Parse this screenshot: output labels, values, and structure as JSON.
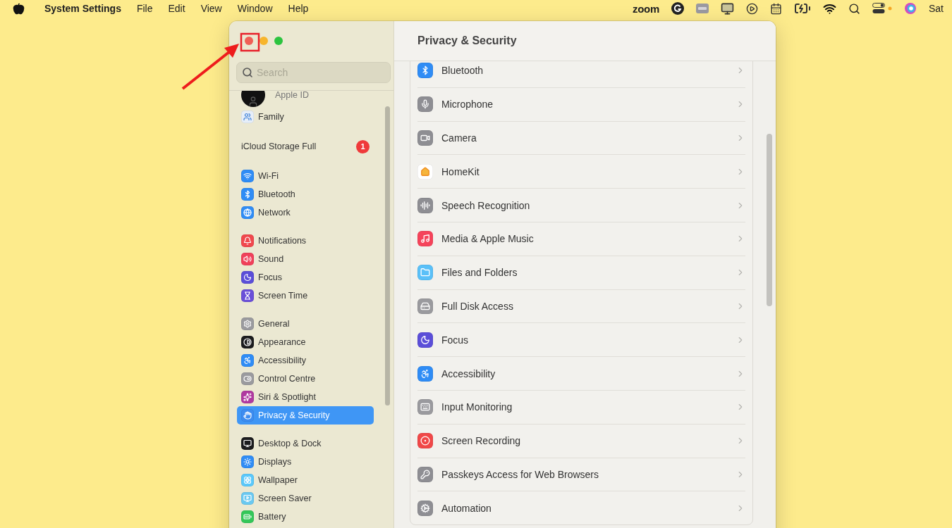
{
  "menu_bar": {
    "app_name": "System Settings",
    "menus": [
      "File",
      "Edit",
      "View",
      "Window",
      "Help"
    ],
    "status_logo": "zoom",
    "clock": "Sat"
  },
  "window": {
    "title": "Privacy & Security",
    "search": {
      "placeholder": "Search"
    },
    "sidebar": {
      "groups": [
        [
          {
            "kind": "avatar",
            "label": "Apple ID",
            "selected": false
          },
          {
            "kind": "icon",
            "label": "Family",
            "color": "#e6eef8",
            "selected": false
          }
        ],
        [
          {
            "kind": "notice",
            "label": "iCloud Storage Full",
            "badge": "1",
            "selected": false
          }
        ],
        [
          {
            "kind": "icon",
            "label": "Wi-Fi",
            "color": "#2f8cf5",
            "selected": false
          },
          {
            "kind": "icon",
            "label": "Bluetooth",
            "color": "#2f8cf5",
            "selected": false
          },
          {
            "kind": "icon",
            "label": "Network",
            "color": "#2f8cf5",
            "selected": false
          }
        ],
        [
          {
            "kind": "icon",
            "label": "Notifications",
            "color": "#f0484d",
            "selected": false
          },
          {
            "kind": "icon",
            "label": "Sound",
            "color": "#f0405a",
            "selected": false
          },
          {
            "kind": "icon",
            "label": "Focus",
            "color": "#5b4ed8",
            "selected": false
          },
          {
            "kind": "icon",
            "label": "Screen Time",
            "color": "#6a4fd8",
            "selected": false
          }
        ],
        [
          {
            "kind": "icon",
            "label": "General",
            "color": "#9a9a9e",
            "selected": false
          },
          {
            "kind": "icon",
            "label": "Appearance",
            "color": "#1c1c1e",
            "selected": false
          },
          {
            "kind": "icon",
            "label": "Accessibility",
            "color": "#2f8cf5",
            "selected": false
          },
          {
            "kind": "icon",
            "label": "Control Centre",
            "color": "#9a9a9e",
            "selected": false
          },
          {
            "kind": "icon",
            "label": "Siri & Spotlight",
            "color": "#b03aa0",
            "selected": false
          },
          {
            "kind": "icon",
            "label": "Privacy & Security",
            "color": "#3d8cf0",
            "selected": true
          }
        ],
        [
          {
            "kind": "icon",
            "label": "Desktop & Dock",
            "color": "#1c1c1e",
            "selected": false
          },
          {
            "kind": "icon",
            "label": "Displays",
            "color": "#2f8cf5",
            "selected": false
          },
          {
            "kind": "icon",
            "label": "Wallpaper",
            "color": "#5ac8fa",
            "selected": false
          },
          {
            "kind": "icon",
            "label": "Screen Saver",
            "color": "#6ac8f0",
            "selected": false
          },
          {
            "kind": "icon",
            "label": "Battery",
            "color": "#34c759",
            "selected": false
          }
        ]
      ]
    },
    "items": [
      {
        "label": "Bluetooth",
        "color": "#2f8cf5"
      },
      {
        "label": "Microphone",
        "color": "#8e8e93"
      },
      {
        "label": "Camera",
        "color": "#8e8e93"
      },
      {
        "label": "HomeKit",
        "color": "#ffffff"
      },
      {
        "label": "Speech Recognition",
        "color": "#8e8e93"
      },
      {
        "label": "Media & Apple Music",
        "color": "#f5435a"
      },
      {
        "label": "Files and Folders",
        "color": "#5ac0f8"
      },
      {
        "label": "Full Disk Access",
        "color": "#9a9a9e"
      },
      {
        "label": "Focus",
        "color": "#5b4ed8"
      },
      {
        "label": "Accessibility",
        "color": "#2f8cf5"
      },
      {
        "label": "Input Monitoring",
        "color": "#9a9a9e"
      },
      {
        "label": "Screen Recording",
        "color": "#f04848"
      },
      {
        "label": "Passkeys Access for Web Browsers",
        "color": "#8e8e93"
      },
      {
        "label": "Automation",
        "color": "#8e8e93"
      }
    ]
  }
}
